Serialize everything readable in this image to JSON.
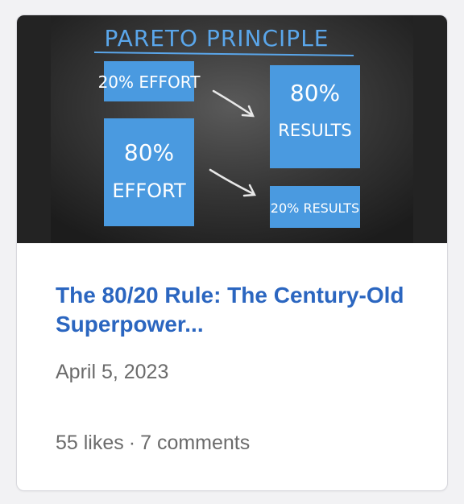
{
  "post": {
    "title": "The 80/20 Rule: The Century-Old Superpower...",
    "date": "April 5, 2023",
    "likes": "55 likes",
    "separator": "·",
    "comments": "7 comments"
  },
  "thumbnail": {
    "heading": "PARETO PRINCIPLE",
    "box_20_effort": "20% EFFORT",
    "box_80_effort_top": "80%",
    "box_80_effort_bottom": "EFFORT",
    "box_80_results_top": "80%",
    "box_80_results_bottom": "RESULTS",
    "box_20_results": "20% RESULTS",
    "colors": {
      "board": "#2a2a2a",
      "box": "#4a9ae0",
      "heading": "#5aa6ea"
    }
  },
  "colors": {
    "title": "#2b66c0",
    "meta": "#6b6b6b"
  }
}
